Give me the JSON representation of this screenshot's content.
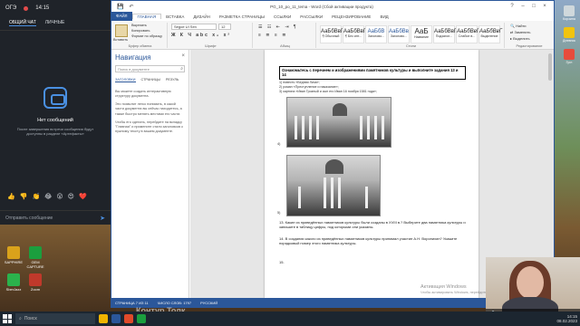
{
  "chat": {
    "room": "ОГЭ",
    "time": "14:15",
    "tabs": [
      "ОБЩИЙ ЧАТ",
      "ЛИЧНЫЕ"
    ],
    "empty_title": "Нет сообщений",
    "empty_desc": "После завершения встречи сообщения будут доступны в разделе «Артефакты»",
    "reactions": [
      "👍",
      "👎",
      "👏",
      "😂",
      "😮",
      "😍",
      "❤️"
    ],
    "send_placeholder": "Отправить сообщение"
  },
  "word": {
    "title": "PG_10_po_11_tema - Word (Сбой активации продукта)",
    "ribbon_tabs": [
      "ФАЙЛ",
      "ГЛАВНАЯ",
      "ВСТАВКА",
      "ДИЗАЙН",
      "РАЗМЕТКА СТРАНИЦЫ",
      "ССЫЛКИ",
      "РАССЫЛКИ",
      "РЕЦЕНЗИРОВАНИЕ",
      "ВИД"
    ],
    "clipboard": {
      "paste": "Вставить",
      "cut": "Вырезать",
      "copy": "Копировать",
      "format": "Формат по образцу",
      "label": "Буфер обмена"
    },
    "font": {
      "name": "Segoe UI Sen",
      "size": "12",
      "label": "Шрифт"
    },
    "paragraph_label": "Абзац",
    "styles": [
      {
        "sample": "АаБбВвГ",
        "name": "¶ Обычный"
      },
      {
        "sample": "АаБбВвГ",
        "name": "¶ Без инт..."
      },
      {
        "sample": "АаБбВ",
        "name": "Заголово..."
      },
      {
        "sample": "АаБбВв",
        "name": "Заголово..."
      },
      {
        "sample": "АаБ",
        "name": "Название"
      },
      {
        "sample": "АаБбВвГ",
        "name": "Подзагол..."
      },
      {
        "sample": "АаБбВвГ",
        "name": "Слабое в..."
      },
      {
        "sample": "АаБбВвГ",
        "name": "Выделение"
      }
    ],
    "styles_label": "Стили",
    "editing": {
      "find": "Найти",
      "replace": "Заменить",
      "select": "Выделить",
      "label": "Редактирование"
    }
  },
  "nav": {
    "title": "Навигация",
    "search_placeholder": "Поиск в документе",
    "tabs": [
      "ЗАГОЛОВКИ",
      "СТРАНИЦЫ",
      "РЕЗУЛЬ"
    ],
    "p1": "Вы можете создать интерактивную структуру документа.",
    "p2": "Это позволит легко понимать, в какой части документа вы сейчас находитесь, а также быстро менять местами его части.",
    "p3": "Чтобы его сделать, перейдите на вкладку \"Главная\" и примените стили заголовков к нужному тексту в вашем документе."
  },
  "doc": {
    "task": "Ознакомьтесь с перечнем и изображениями памятников культуры и выполните задания 13 и 14",
    "items": [
      "1) повесть «Бедная Лиза»;",
      "2) роман «Преступление и наказание»;",
      "3) картина «Иван Грозный и сын его Иван 16 ноября 1581 года»;"
    ],
    "num4": "4)",
    "num5": "5)",
    "q13": "13. Какие из приведённых памятников культуры были созданы в XVIII в.? Выберите два памятника культуры и запишите в таблицу цифры, под которыми они указаны.",
    "q14": "14. В создании какого из приведённых памятников культуры принимал участие А.Н. Воронихин? Укажите порядковый номер этого памятника культуры.",
    "q15": "15."
  },
  "status": {
    "page": "СТРАНИЦА 7 ИЗ 11",
    "words": "ЧИСЛО СЛОВ: 1797",
    "lang": "РУССКИЙ",
    "zoom": "100%"
  },
  "activation": {
    "line1": "Активация Windows",
    "line2": "Чтобы активировать Windows, перейдите в раздел \"Параметры\"."
  },
  "webcam": {
    "name": "Виктория Юршина"
  },
  "watermark": "Контур.Толк",
  "desktop_icons": [
    "SAPPHIRE",
    "GEM CAPTURE",
    "SberJazz",
    "Zoom",
    "WinRAR Setup",
    "Canon Quick"
  ],
  "right_icons": [
    "Корзина",
    "Дневник",
    "Гугл"
  ],
  "taskbar": {
    "search": "Поиск",
    "time": "14:15",
    "date": "08.02.2023"
  },
  "colors": {
    "word_blue": "#2b579a",
    "chat_bg": "#1f2329",
    "accent": "#4a90e2"
  }
}
